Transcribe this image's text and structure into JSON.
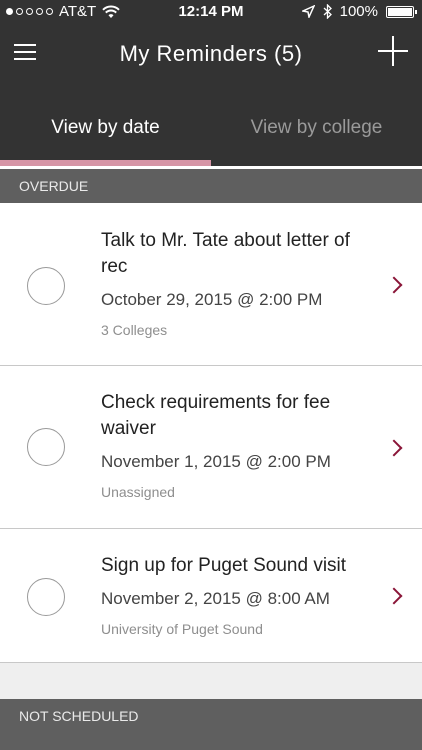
{
  "status_bar": {
    "carrier": "AT&T",
    "time": "12:14 PM",
    "battery": "100%",
    "signal_dots_filled": 1,
    "signal_dots_total": 5
  },
  "nav": {
    "title": "My Reminders (5)"
  },
  "tabs": [
    {
      "label": "View by date",
      "active": true
    },
    {
      "label": "View by college",
      "active": false
    }
  ],
  "sections": {
    "overdue": "OVERDUE",
    "unscheduled": "NOT SCHEDULED"
  },
  "reminders": [
    {
      "title": "Talk to Mr. Tate about letter of rec",
      "date": "October 29, 2015 @ 2:00 PM",
      "subtitle": "3 Colleges"
    },
    {
      "title": "Check requirements for fee waiver",
      "date": "November 1, 2015 @ 2:00 PM",
      "subtitle": "Unassigned"
    },
    {
      "title": "Sign up for Puget Sound visit",
      "date": "November 2, 2015 @ 8:00 AM",
      "subtitle": "University of Puget Sound"
    }
  ],
  "colors": {
    "bar_bg": "#333333",
    "accent": "#d695a6",
    "chevron": "#8a1538",
    "section_bg": "#5f5f5f"
  }
}
